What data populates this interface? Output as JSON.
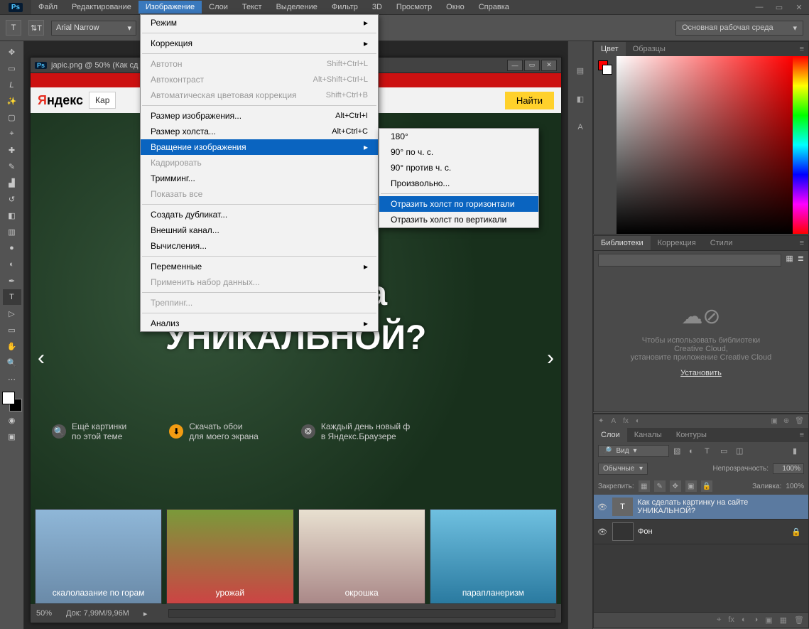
{
  "menubar": [
    "Файл",
    "Редактирование",
    "Изображение",
    "Слои",
    "Текст",
    "Выделение",
    "Фильтр",
    "3D",
    "Просмотр",
    "Окно",
    "Справка"
  ],
  "menubar_open_index": 2,
  "options": {
    "font": "Arial Narrow",
    "workspace": "Основная рабочая среда",
    "three_d": "3D"
  },
  "document": {
    "title": "japic.png @ 50% (Как сд",
    "zoom": "50%",
    "docsize": "Док: 7,99M/9,96M"
  },
  "page_content": {
    "yandex_logo_y": "Я",
    "yandex_logo_rest": "ндекс",
    "kap": "Кар",
    "find": "Найти",
    "hero_line1": "артинку на",
    "hero_line2": "УНИКАЛЬНОЙ?",
    "links": [
      {
        "l1": "Ещё картинки",
        "l2": "по этой теме"
      },
      {
        "l1": "Скачать обои",
        "l2": "для моего экрана"
      },
      {
        "l1": "Каждый день новый ф",
        "l2": "в Яндекс.Браузере"
      }
    ],
    "thumbs": [
      "скалолазание по горам",
      "урожай",
      "окрошка",
      "парапланеризм"
    ]
  },
  "menu": {
    "items": [
      {
        "label": "Режим",
        "arrow": true
      },
      {
        "sep": true
      },
      {
        "label": "Коррекция",
        "arrow": true
      },
      {
        "sep": true
      },
      {
        "label": "Автотон",
        "shortcut": "Shift+Ctrl+L",
        "disabled": true
      },
      {
        "label": "Автоконтраст",
        "shortcut": "Alt+Shift+Ctrl+L",
        "disabled": true
      },
      {
        "label": "Автоматическая цветовая коррекция",
        "shortcut": "Shift+Ctrl+B",
        "disabled": true
      },
      {
        "sep": true
      },
      {
        "label": "Размер изображения...",
        "shortcut": "Alt+Ctrl+I"
      },
      {
        "label": "Размер холста...",
        "shortcut": "Alt+Ctrl+C"
      },
      {
        "label": "Вращение изображения",
        "arrow": true,
        "highlight": true
      },
      {
        "label": "Кадрировать",
        "disabled": true
      },
      {
        "label": "Тримминг..."
      },
      {
        "label": "Показать все",
        "disabled": true
      },
      {
        "sep": true
      },
      {
        "label": "Создать дубликат..."
      },
      {
        "label": "Внешний канал..."
      },
      {
        "label": "Вычисления..."
      },
      {
        "sep": true
      },
      {
        "label": "Переменные",
        "arrow": true
      },
      {
        "label": "Применить набор данных...",
        "disabled": true
      },
      {
        "sep": true
      },
      {
        "label": "Треппинг...",
        "disabled": true
      },
      {
        "sep": true
      },
      {
        "label": "Анализ",
        "arrow": true
      }
    ]
  },
  "submenu": {
    "items": [
      {
        "label": "180°"
      },
      {
        "label": "90° по ч. с."
      },
      {
        "label": "90° против ч. с."
      },
      {
        "label": "Произвольно..."
      },
      {
        "sep": true
      },
      {
        "label": "Отразить холст по горизонтали",
        "highlight": true
      },
      {
        "label": "Отразить холст по вертикали"
      }
    ]
  },
  "panels": {
    "color_tabs": [
      "Цвет",
      "Образцы"
    ],
    "lib_tabs": [
      "Библиотеки",
      "Коррекция",
      "Стили"
    ],
    "lib_text1": "Чтобы использовать библиотеки",
    "lib_text2": "Creative Cloud,",
    "lib_text3": "установите приложение Creative Cloud",
    "lib_install": "Установить",
    "layer_tabs": [
      "Слои",
      "Каналы",
      "Контуры"
    ],
    "filter_label": "Вид",
    "blend": "Обычные",
    "opacity_label": "Непрозрачность:",
    "opacity_val": "100%",
    "lock_label": "Закрепить:",
    "fill_label": "Заливка:",
    "fill_val": "100%",
    "layers": [
      {
        "name": "Как сделать картинку на сайте УНИКАЛЬНОЙ?",
        "type": "T",
        "sel": true
      },
      {
        "name": "Фон",
        "type": "img",
        "locked": true
      }
    ]
  }
}
